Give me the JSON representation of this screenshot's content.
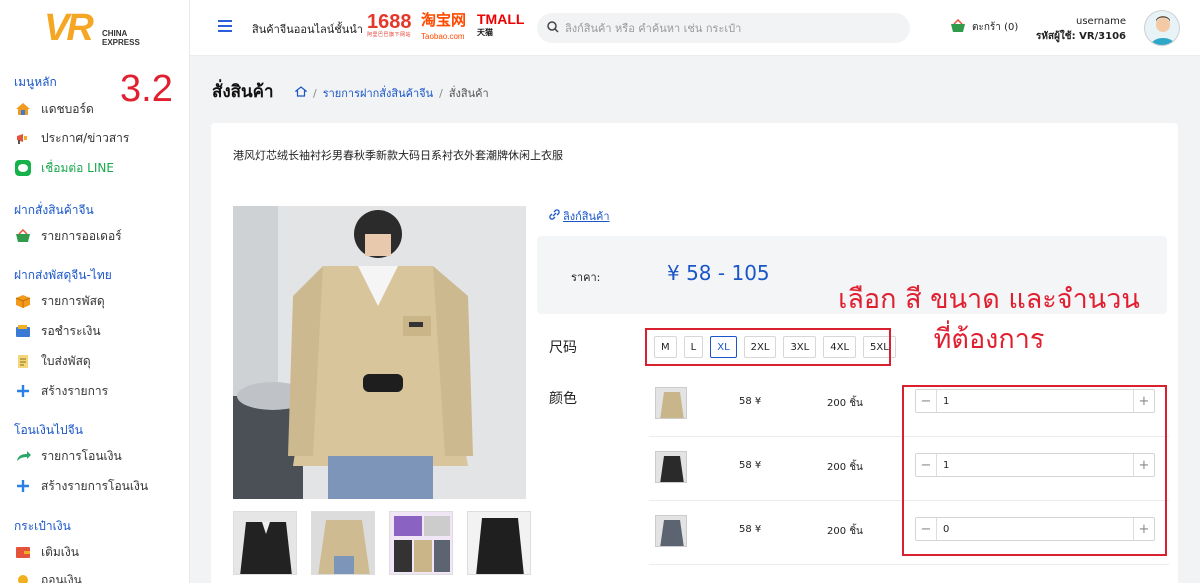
{
  "logo": {
    "text": "VR",
    "subtitle1": "CHINA",
    "subtitle2": "EXPRESS"
  },
  "step_badge": "3.2",
  "sidebar": {
    "sections": [
      {
        "title": "เมนูหลัก",
        "items": [
          {
            "label": "แดชบอร์ด",
            "icon": "home-icon"
          },
          {
            "label": "ประกาศ/ข่าวสาร",
            "icon": "megaphone-icon"
          },
          {
            "label": "เชื่อมต่อ LINE",
            "icon": "line-icon"
          }
        ]
      },
      {
        "title": "ฝากสั่งสินค้าจีน",
        "items": [
          {
            "label": "รายการออเดอร์",
            "icon": "basket-icon"
          }
        ]
      },
      {
        "title": "ฝากส่งพัสดุจีน-ไทย",
        "items": [
          {
            "label": "รายการพัสดุ",
            "icon": "box-icon"
          },
          {
            "label": "รอชำระเงิน",
            "icon": "wallet-icon"
          },
          {
            "label": "ใบส่งพัสดุ",
            "icon": "document-icon"
          },
          {
            "label": "สร้างรายการ",
            "icon": "plus-icon"
          }
        ]
      },
      {
        "title": "โอนเงินไปจีน",
        "items": [
          {
            "label": "รายการโอนเงิน",
            "icon": "transfer-icon"
          },
          {
            "label": "สร้างรายการโอนเงิน",
            "icon": "plus-icon"
          }
        ]
      },
      {
        "title": "กระเป๋าเงิน",
        "items": [
          {
            "label": "เติมเงิน",
            "icon": "topup-icon"
          },
          {
            "label": "ถอนเงิน",
            "icon": "withdraw-icon"
          }
        ]
      }
    ]
  },
  "header": {
    "tagline": "สินค้าจีนออนไลน์ชั้นนำ",
    "brands": {
      "b1688": "1688",
      "b1688_sub": "阿里巴巴旗下网站",
      "taobao": "淘宝网",
      "taobao_sub": "Taobao.com",
      "tmall": "TMALL",
      "tmall_sub": "天猫"
    },
    "search_placeholder": "ลิงก์สินค้า หรือ คำค้นหา เช่น กระเป๋า",
    "cart_label": "ตะกร้า (0)",
    "username": "username",
    "user_code": "รหัสผู้ใช้: VR/3106"
  },
  "page": {
    "title": "สั่งสินค้า",
    "breadcrumb": [
      "รายการฝากสั่งสินค้าจีน",
      "สั่งสินค้า"
    ]
  },
  "product": {
    "title": "港风灯芯绒长袖衬衫男春秋季新款大码日系衬衣外套潮牌休闲上衣服",
    "link_label": "ลิงก์สินค้า",
    "price_label": "ราคา:",
    "price_value": "¥ 58 - 105",
    "size_label": "尺码",
    "sizes": [
      "M",
      "L",
      "XL",
      "2XL",
      "3XL",
      "4XL",
      "5XL"
    ],
    "selected_size": "XL",
    "color_label": "颜色",
    "variants": [
      {
        "price": "58 ¥",
        "stock": "200 ชิ้น",
        "qty": "1",
        "swatch": "#c9b58a"
      },
      {
        "price": "58 ¥",
        "stock": "200 ชิ้น",
        "qty": "1",
        "swatch": "#2a2a2a"
      },
      {
        "price": "58 ¥",
        "stock": "200 ชิ้น",
        "qty": "0",
        "swatch": "#5b6470"
      }
    ]
  },
  "annotation": {
    "line1": "เลือก สี ขนาด และจำนวน",
    "line2": "ที่ต้องการ"
  },
  "colors": {
    "accent": "#1a56c8",
    "highlight": "#d9202f",
    "line_green": "#17a84b"
  }
}
